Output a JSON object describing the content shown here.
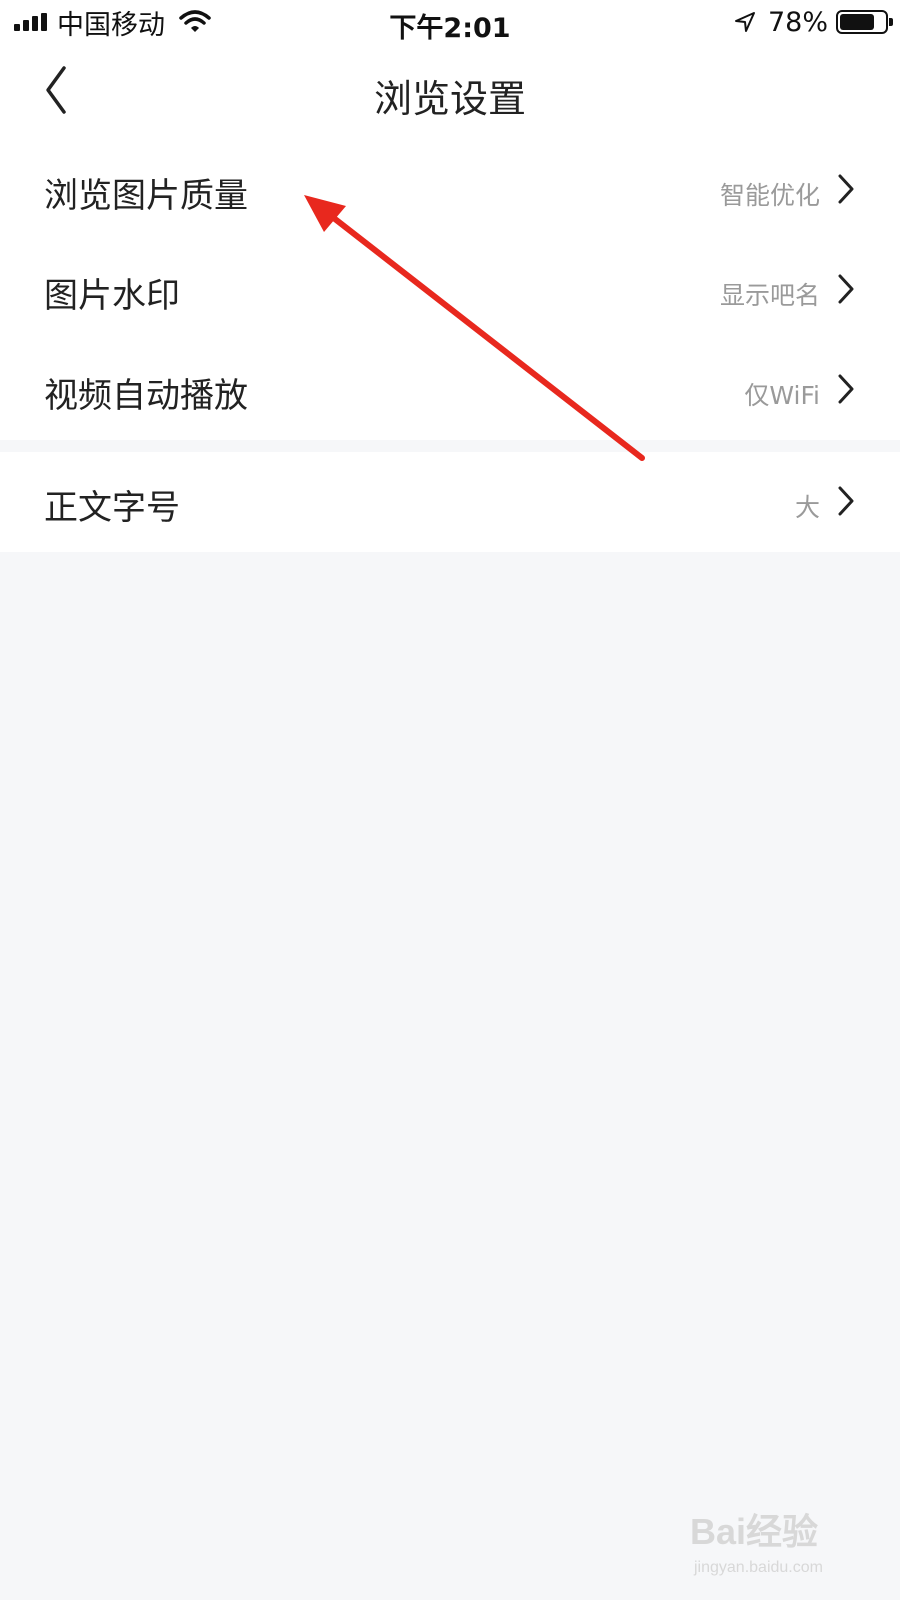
{
  "status_bar": {
    "carrier": "中国移动",
    "time": "下午2:01",
    "battery": "78%",
    "battery_level": 0.78,
    "icons": [
      "signal-icon",
      "wifi-icon",
      "location-icon",
      "battery-icon"
    ]
  },
  "nav": {
    "title": "浏览设置",
    "back_icon": "chevron-left-icon"
  },
  "settings": {
    "group1": [
      {
        "label": "浏览图片质量",
        "value": "智能优化"
      },
      {
        "label": "图片水印",
        "value": "显示吧名"
      },
      {
        "label": "视频自动播放",
        "value": "仅WiFi"
      }
    ],
    "group2": [
      {
        "label": "正文字号",
        "value": "大"
      }
    ]
  },
  "annotation": {
    "color": "#e8281e",
    "icon": "red-arrow-annotation"
  },
  "watermark": {
    "text": "Bai经验",
    "sub": "jingyan.baidu.com"
  },
  "colors": {
    "background": "#f6f7f9",
    "text": "#222222",
    "secondary_text": "#9a9a9a",
    "annotation": "#e8281e"
  }
}
